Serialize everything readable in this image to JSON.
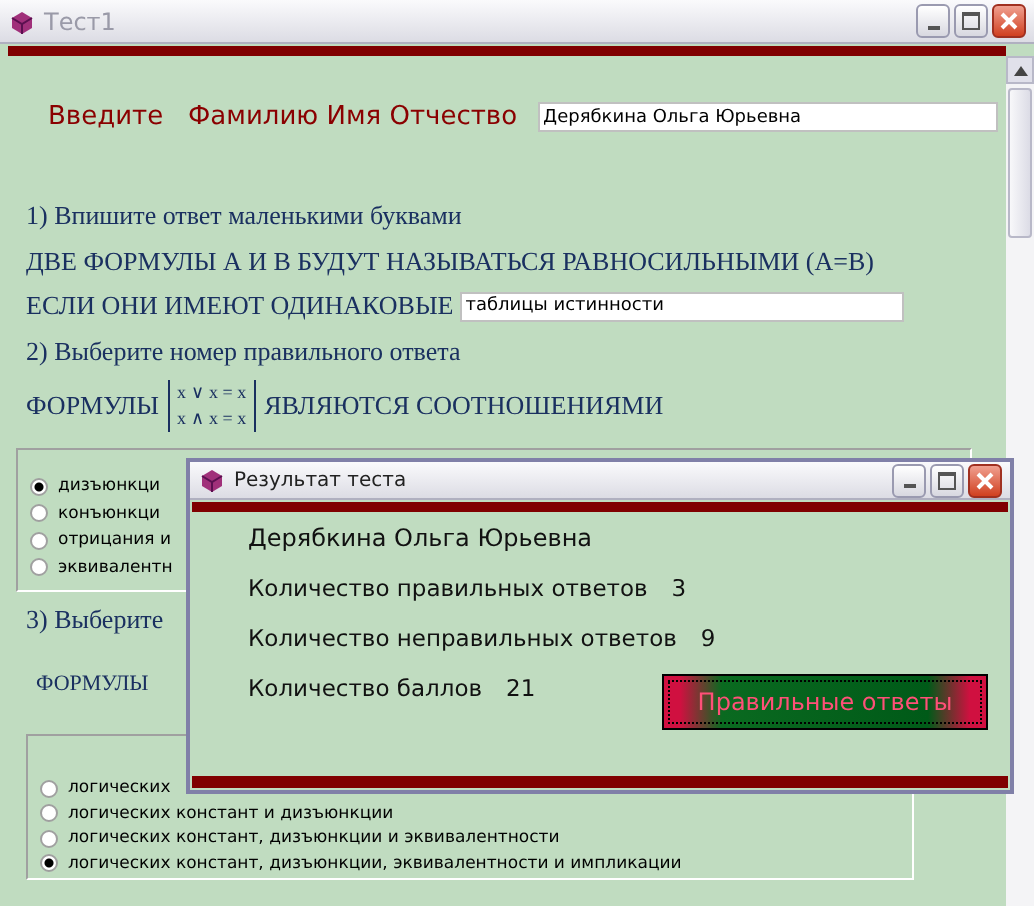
{
  "window": {
    "title": "Тест1"
  },
  "name_prompt": {
    "label": "Введите   Фамилию Имя Отчество",
    "value": "Дерябкина Ольга Юрьевна"
  },
  "question_1": {
    "title": "1) Впишите ответ маленькими буквами",
    "line_1": "ДВЕ ФОРМУЛЫ А И В БУДУТ НАЗЫВАТЬСЯ РАВНОСИЛЬНЫМИ (A=B)",
    "line_2": "ЕСЛИ ОНИ ИМЕЮТ ОДИНАКОВЫЕ",
    "answer": "таблицы истинности"
  },
  "question_2": {
    "title": "2) Выберите номер правильного ответа",
    "prefix": "ФОРМУЛЫ",
    "formulas": [
      "x ∨ x = x",
      "x ∧ x = x"
    ],
    "suffix": "ЯВЛЯЮТСЯ СООТНОШЕНИЯМИ",
    "options": [
      {
        "label": "дизъюнкци",
        "selected": true
      },
      {
        "label": "конъюнкци",
        "selected": false
      },
      {
        "label": "отрицания и",
        "selected": false
      },
      {
        "label": "эквивалентн",
        "selected": false
      }
    ]
  },
  "question_3": {
    "title": "3) Выберите",
    "prefix": "ФОРМУЛЫ",
    "options": [
      {
        "label": "логических",
        "selected": false
      },
      {
        "label": "логических констант и дизъюнкции",
        "selected": false
      },
      {
        "label": "логических констант, дизъюнкции и эквивалентности",
        "selected": false
      },
      {
        "label": "логических констант, дизъюнкции, эквивалентности и импликации",
        "selected": true
      }
    ]
  },
  "result_dialog": {
    "title": "Результат теста",
    "name": "Дерябкина Ольга Юрьевна",
    "lines": [
      {
        "label": "Количество правильных ответов",
        "value": "3"
      },
      {
        "label": "Количество неправильных ответов",
        "value": "9"
      },
      {
        "label": "Количество баллов",
        "value": "21"
      }
    ],
    "button": "Правильные ответы"
  }
}
